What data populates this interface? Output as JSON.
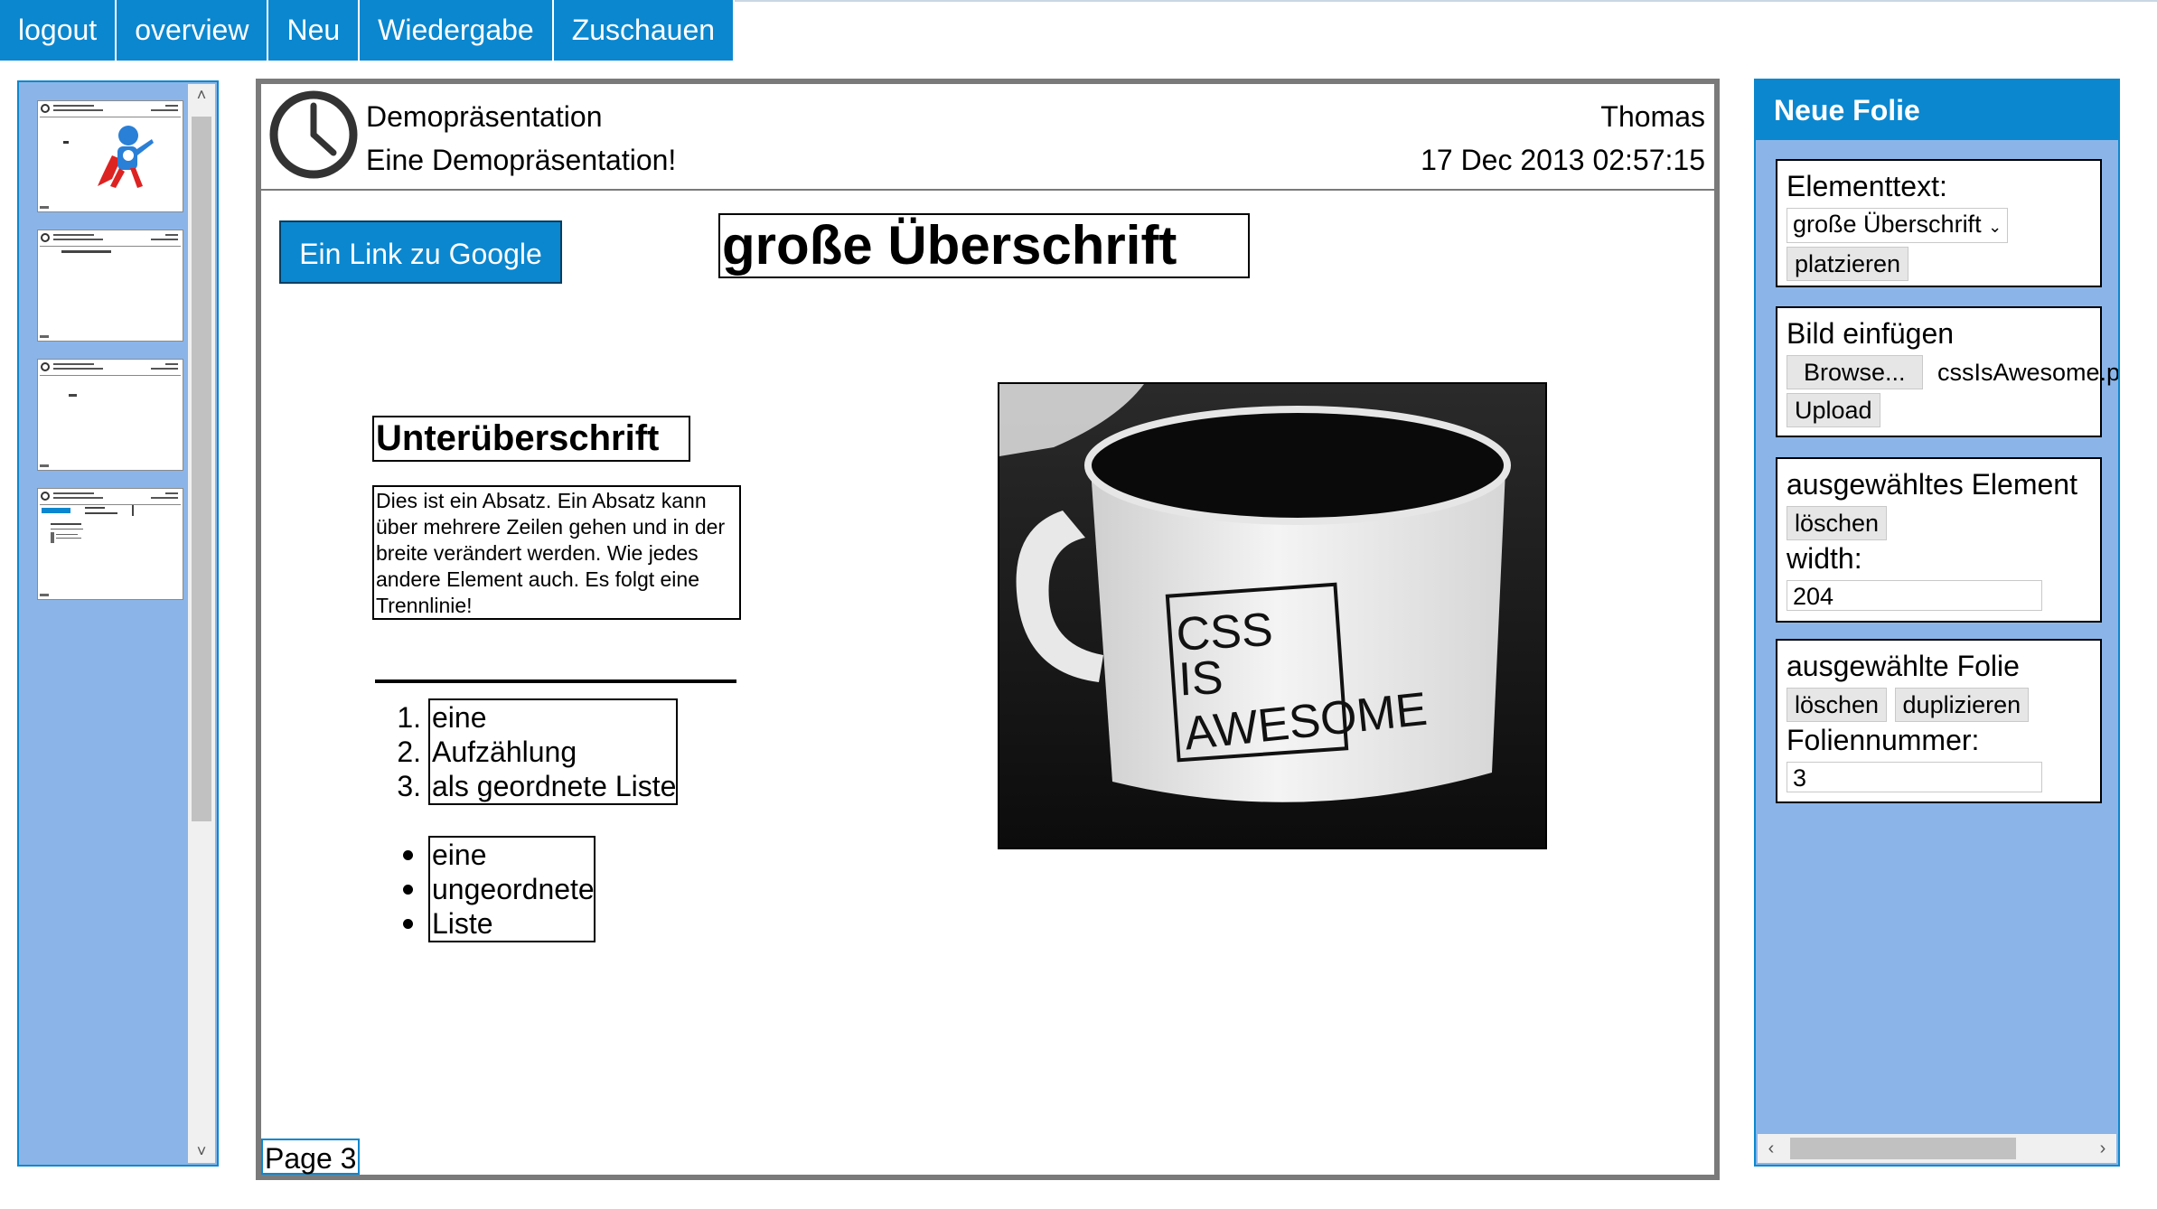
{
  "nav": [
    "logout",
    "overview",
    "Neu",
    "Wiedergabe",
    "Zuschauen"
  ],
  "slide": {
    "title": "Demopräsentation",
    "subtitle": "Eine Demopräsentation!",
    "author": "Thomas",
    "date": "17 Dec 2013 02:57:15",
    "link_button": "Ein Link zu Google",
    "heading1": "große Überschrift",
    "heading2": "Unterüberschrift",
    "paragraph": "Dies ist ein Absatz. Ein Absatz kann über mehrere Zeilen gehen und in der breite verändert werden. Wie jedes andere Element auch. Es folgt eine Trennlinie!",
    "ordered_list": [
      "eine",
      "Aufzählung",
      "als geordnete Liste"
    ],
    "unordered_list": [
      "eine",
      "ungeordnete",
      "Liste"
    ],
    "image_text": [
      "CSS",
      "IS",
      "AWESOME"
    ],
    "page_label": "Page 3"
  },
  "right_panel": {
    "title": "Neue Folie",
    "element_text": {
      "label": "Elementtext:",
      "select_value": "große Überschrift",
      "button": "platzieren"
    },
    "image_insert": {
      "label": "Bild einfügen",
      "browse_button": "Browse...",
      "filename": "cssIsAwesome.pn",
      "upload_button": "Upload"
    },
    "selected_element": {
      "label": "ausgewähltes Element",
      "delete_button": "löschen",
      "width_label": "width:",
      "width_value": "204"
    },
    "selected_slide": {
      "label": "ausgewählte Folie",
      "delete_button": "löschen",
      "duplicate_button": "duplizieren",
      "number_label": "Foliennummer:",
      "number_value": "3"
    }
  },
  "colors": {
    "accent": "#0b87cf",
    "panel": "#8bb5e8",
    "slide_border": "#7a7a7a"
  }
}
